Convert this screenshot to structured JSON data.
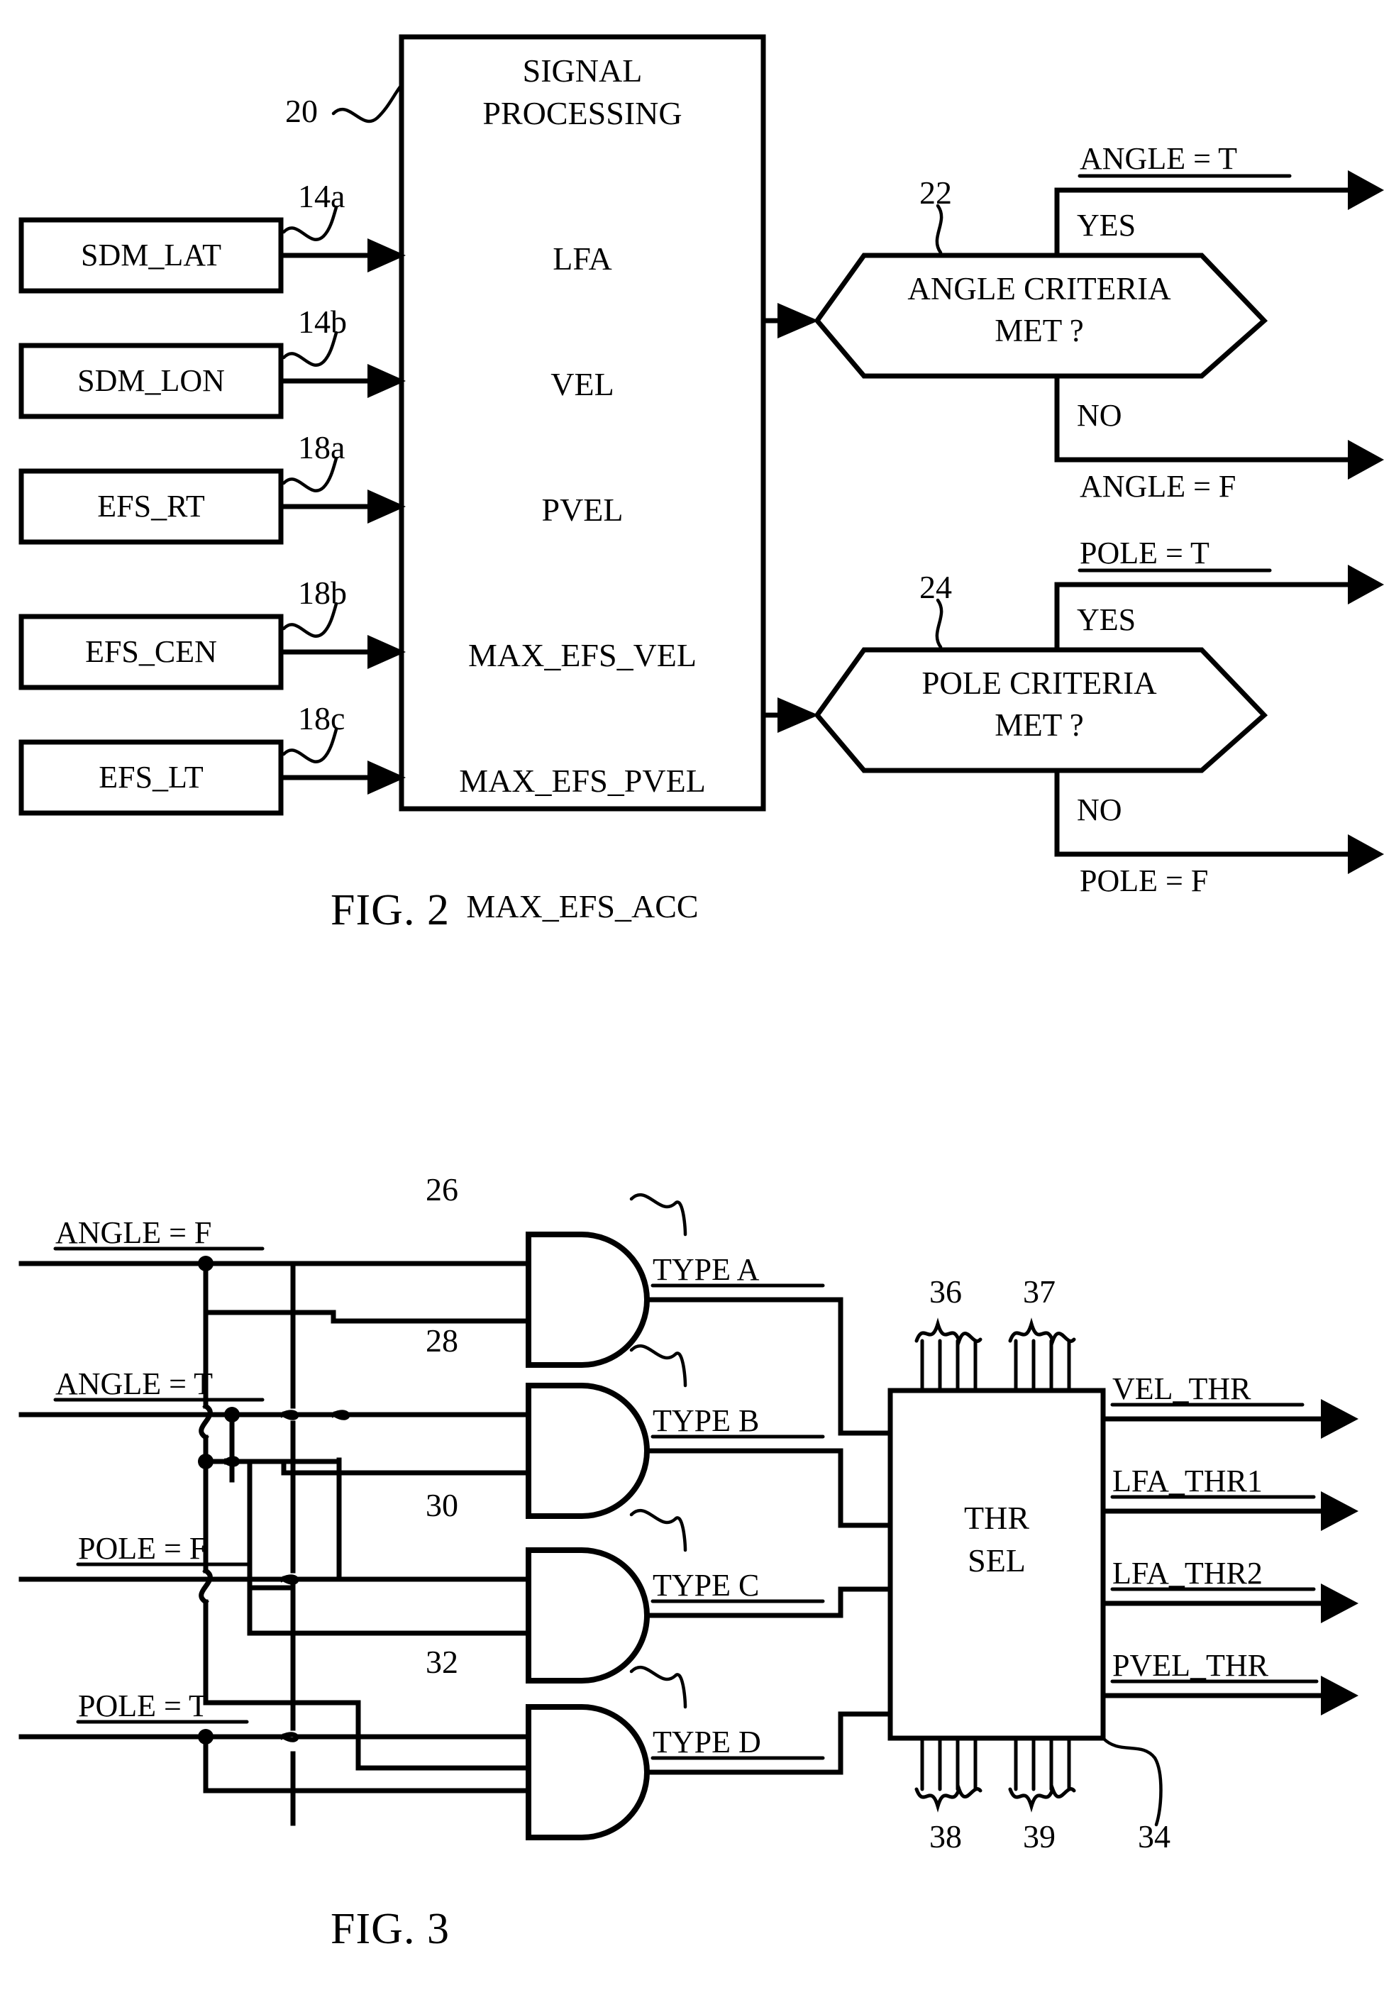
{
  "document": {
    "kind": "patent-drawing-sheet"
  },
  "figures": [
    {
      "id": "fig2",
      "caption": "FIG. 2",
      "processing_block": {
        "ref": "20",
        "title_line1": "SIGNAL",
        "title_line2": "PROCESSING",
        "items": [
          "LFA",
          "VEL",
          "PVEL",
          "MAX_EFS_VEL",
          "MAX_EFS_PVEL",
          "MAX_EFS_ACC"
        ]
      },
      "inputs": [
        {
          "label": "SDM_LAT",
          "ref": "14a"
        },
        {
          "label": "SDM_LON",
          "ref": "14b"
        },
        {
          "label": "EFS_RT",
          "ref": "18a"
        },
        {
          "label": "EFS_CEN",
          "ref": "18b"
        },
        {
          "label": "EFS_LT",
          "ref": "18c"
        }
      ],
      "decisions": [
        {
          "ref": "22",
          "line1": "ANGLE CRITERIA",
          "line2": "MET ?",
          "yes_label": "YES",
          "no_label": "NO",
          "yes_output": "ANGLE = T",
          "no_output": "ANGLE = F"
        },
        {
          "ref": "24",
          "line1": "POLE CRITERIA",
          "line2": "MET ?",
          "yes_label": "YES",
          "no_label": "NO",
          "yes_output": "POLE = T",
          "no_output": "POLE = F"
        }
      ]
    },
    {
      "id": "fig3",
      "caption": "FIG. 3",
      "signals": [
        {
          "label": "ANGLE = F"
        },
        {
          "label": "ANGLE = T"
        },
        {
          "label": "POLE = F"
        },
        {
          "label": "POLE = T"
        }
      ],
      "gates": [
        {
          "ref": "26",
          "output": "TYPE A",
          "kind": "and-gate"
        },
        {
          "ref": "28",
          "output": "TYPE B",
          "kind": "and-gate"
        },
        {
          "ref": "30",
          "output": "TYPE C",
          "kind": "and-gate"
        },
        {
          "ref": "32",
          "output": "TYPE D",
          "kind": "and-gate"
        }
      ],
      "selector": {
        "ref": "34",
        "line1": "THR",
        "line2": "SEL",
        "top_bus_refs": [
          "36",
          "37"
        ],
        "bottom_bus_refs": [
          "38",
          "39"
        ],
        "outputs": [
          "VEL_THR",
          "LFA_THR1",
          "LFA_THR2",
          "PVEL_THR"
        ]
      }
    }
  ],
  "colors": {
    "ink": "#000000",
    "paper": "#ffffff"
  }
}
